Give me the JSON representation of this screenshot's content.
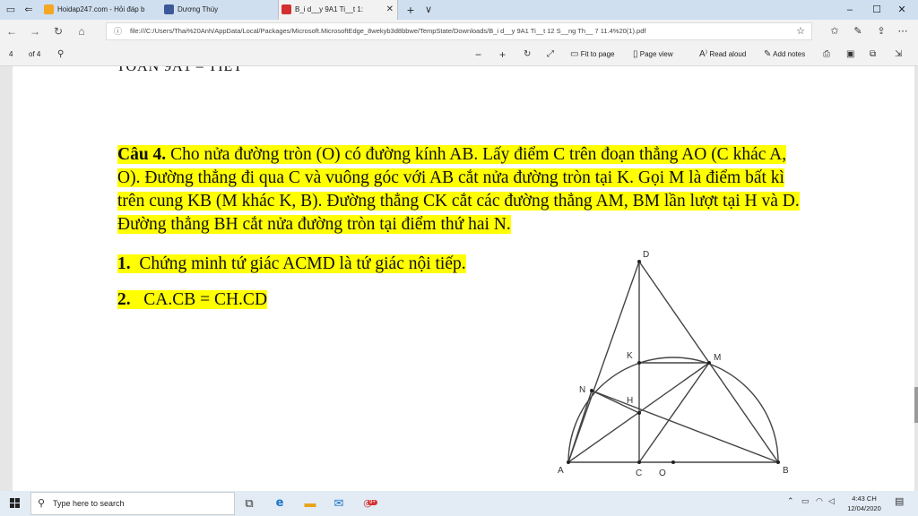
{
  "tabs": [
    {
      "title": "Hoidap247.com - Hỏi đáp b",
      "favicon_color": "#f5a623"
    },
    {
      "title": "Dương Thùy",
      "favicon_color": "#3b5998"
    },
    {
      "title": "B_i d__y 9A1 Ti__t 1:",
      "favicon_color": "#d32f2f"
    }
  ],
  "tabbar": {
    "new_tab": "+",
    "menu": "∨",
    "close_tab": "✕"
  },
  "window": {
    "minimize": "–",
    "maximize": "☐",
    "close": "✕"
  },
  "address": {
    "url": "file:///C:/Users/Thai%20Anh/AppData/Local/Packages/Microsoft.MicrosoftEdge_8wekyb3d8bbwe/TempState/Downloads/B_i d__y 9A1 Ti__t 12 S__ng Th__ 7 11.4%20(1).pdf",
    "back": "←",
    "forward": "→",
    "refresh": "↻",
    "home": "⌂",
    "info": "ⓘ",
    "favorite": "☆"
  },
  "pdf_toolbar": {
    "page_number": "4",
    "page_total": "of 4",
    "fit_to_page": "Fit to page",
    "page_view": "Page view",
    "read_aloud": "Read aloud",
    "add_notes": "Add notes"
  },
  "document": {
    "header_fragment": "TOÁN 9A1 – TIẾT",
    "question_label": "Câu 4.",
    "question_text": " Cho nửa đường tròn (O) có đường kính AB. Lấy điểm C trên đoạn thẳng AO (C khác A, O). Đường thẳng đi qua C và vuông góc với AB cắt nửa đường tròn tại K. Gọi M là điểm bất kì trên cung KB (M khác K, B). Đường thẳng CK cắt các đường thẳng AM, BM lần lượt tại H và D. Đường thẳng BH cắt nửa đường tròn tại điểm thứ hai N.",
    "item1_num": "1.",
    "item1_text": "Chứng minh tứ giác ACMD là tứ giác nội tiếp.",
    "item2_num": "2.",
    "item2_text": "CA.CB = CH.CD"
  },
  "figure_labels": {
    "A": "A",
    "B": "B",
    "C": "C",
    "O": "O",
    "D": "D",
    "K": "K",
    "M": "M",
    "H": "H",
    "N": "N"
  },
  "taskbar": {
    "search_placeholder": "Type here to search",
    "time": "4:43 CH",
    "date": "12/04/2020",
    "mail_badge": "9+"
  }
}
